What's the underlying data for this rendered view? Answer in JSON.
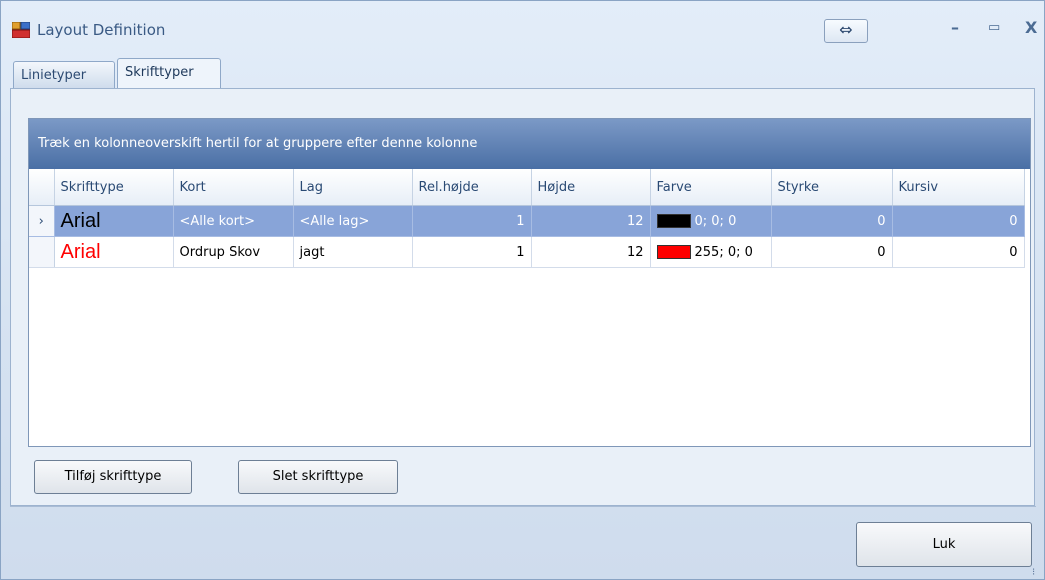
{
  "window": {
    "title": "Layout Definition",
    "resize_glyph": "⇔",
    "minimize_glyph": "–",
    "maximize_glyph": "▭",
    "close_glyph": "X"
  },
  "tabs": [
    {
      "label": "Linietyper",
      "active": false
    },
    {
      "label": "Skrifttyper",
      "active": true
    }
  ],
  "grid": {
    "group_panel_text": "Træk en kolonneoverskift hertil for at gruppere efter denne kolonne",
    "columns": [
      "Skrifttype",
      "Kort",
      "Lag",
      "Rel.højde",
      "Højde",
      "Farve",
      "Styrke",
      "Kursiv"
    ],
    "rows": [
      {
        "indicator": "›",
        "font": "Arial",
        "font_color": "#000000",
        "kort": "<Alle kort>",
        "lag": "<Alle lag>",
        "rel_hojde": "1",
        "hojde": "12",
        "farve_swatch": "#000000",
        "farve_text": "0; 0; 0",
        "styrke": "0",
        "kursiv": "0",
        "selected": true
      },
      {
        "indicator": "",
        "font": "Arial",
        "font_color": "#ff0000",
        "kort": "Ordrup Skov",
        "lag": "jagt",
        "rel_hojde": "1",
        "hojde": "12",
        "farve_swatch": "#ff0000",
        "farve_text": "255; 0; 0",
        "styrke": "0",
        "kursiv": "0",
        "selected": false
      }
    ]
  },
  "buttons": {
    "add": "Tilføj skrifttype",
    "delete": "Slet skrifttype",
    "close": "Luk"
  },
  "grip_glyph": "⁝"
}
